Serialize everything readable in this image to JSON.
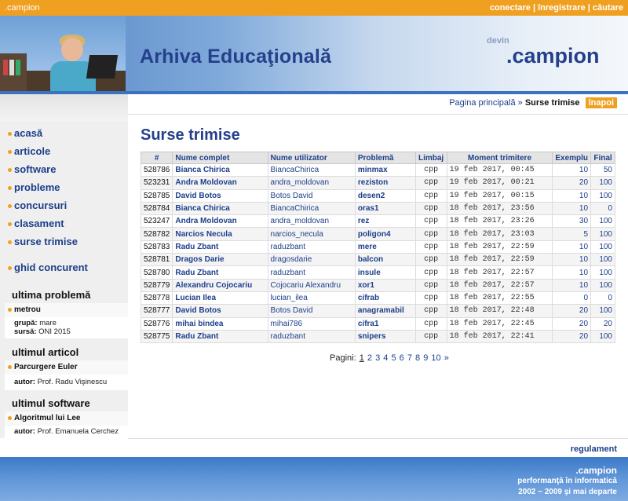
{
  "topbar": {
    "brand": ".campion",
    "login": "conectare",
    "register": "înregistrare",
    "search": "căutare",
    "sep": "|",
    "color": "#f0a020"
  },
  "header": {
    "title": "Arhiva Educaţională",
    "devin": "devin",
    "logo": ".campion"
  },
  "breadcrumb": {
    "home": "Pagina principală",
    "sep": "»",
    "current": "Surse trimise",
    "back": "înapoi"
  },
  "sidebar": {
    "nav": [
      "acasă",
      "articole",
      "software",
      "probleme",
      "concursuri",
      "clasament",
      "surse trimise"
    ],
    "guide": "ghid concurent",
    "last_problem": {
      "title": "ultima problemă",
      "name": "metrou",
      "group_label": "grupă:",
      "group": "mare",
      "source_label": "sursă:",
      "source": "ONI 2015"
    },
    "last_article": {
      "title": "ultimul articol",
      "name": "Parcurgere Euler",
      "author_label": "autor:",
      "author": "Prof. Radu Vişinescu"
    },
    "last_software": {
      "title": "ultimul software",
      "name": "Algoritmul lui Lee",
      "author_label": "autor:",
      "author": "Prof. Emanuela Cerchez"
    }
  },
  "main": {
    "title": "Surse trimise",
    "columns": [
      "#",
      "Nume complet",
      "Nume utilizator",
      "Problemă",
      "Limbaj",
      "Moment trimitere",
      "Exemplu",
      "Final"
    ],
    "rows": [
      [
        "528786",
        "Bianca Chirica",
        "BiancaChirica",
        "minmax",
        "cpp",
        "19 feb 2017, 00:45",
        "10",
        "50"
      ],
      [
        "523231",
        "Andra Moldovan",
        "andra_moldovan",
        "reziston",
        "cpp",
        "19 feb 2017, 00:21",
        "20",
        "100"
      ],
      [
        "528785",
        "David Botos",
        "Botos David",
        "desen2",
        "cpp",
        "19 feb 2017, 00:15",
        "10",
        "100"
      ],
      [
        "528784",
        "Bianca Chirica",
        "BiancaChirica",
        "oras1",
        "cpp",
        "18 feb 2017, 23:56",
        "10",
        "0"
      ],
      [
        "523247",
        "Andra Moldovan",
        "andra_moldovan",
        "rez",
        "cpp",
        "18 feb 2017, 23:26",
        "30",
        "100"
      ],
      [
        "528782",
        "Narcios Necula",
        "narcios_necula",
        "poligon4",
        "cpp",
        "18 feb 2017, 23:03",
        "5",
        "100"
      ],
      [
        "528783",
        "Radu Zbant",
        "raduzbant",
        "mere",
        "cpp",
        "18 feb 2017, 22:59",
        "10",
        "100"
      ],
      [
        "528781",
        "Dragos Darie",
        "dragosdarie",
        "balcon",
        "cpp",
        "18 feb 2017, 22:59",
        "10",
        "100"
      ],
      [
        "528780",
        "Radu Zbant",
        "raduzbant",
        "insule",
        "cpp",
        "18 feb 2017, 22:57",
        "10",
        "100"
      ],
      [
        "528779",
        "Alexandru Cojocariu",
        "Cojocariu Alexandru",
        "xor1",
        "cpp",
        "18 feb 2017, 22:57",
        "10",
        "100"
      ],
      [
        "528778",
        "Lucian Ilea",
        "lucian_ilea",
        "cifrab",
        "cpp",
        "18 feb 2017, 22:55",
        "0",
        "0"
      ],
      [
        "528777",
        "David Botos",
        "Botos David",
        "anagramabil",
        "cpp",
        "18 feb 2017, 22:48",
        "20",
        "100"
      ],
      [
        "528776",
        "mihai bindea",
        "mihai786",
        "cifra1",
        "cpp",
        "18 feb 2017, 22:45",
        "20",
        "20"
      ],
      [
        "528775",
        "Radu Zbant",
        "raduzbant",
        "snipers",
        "cpp",
        "18 feb 2017, 22:41",
        "20",
        "100"
      ]
    ],
    "pager": {
      "label": "Pagini:",
      "pages": [
        "1",
        "2",
        "3",
        "4",
        "5",
        "6",
        "7",
        "8",
        "9",
        "10"
      ],
      "next": "»"
    },
    "regulament": "regulament"
  },
  "footer": {
    "line1": ".campion",
    "line2": "performanţă în informatică",
    "line3": "2002 ~ 2009 şi mai departe"
  }
}
